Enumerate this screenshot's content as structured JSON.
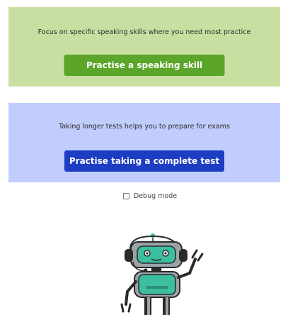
{
  "speaking_skill": {
    "description": "Focus on specific speaking skills where you need most practice",
    "button_label": "Practise a speaking skill",
    "panel_color": "#c8dfa2",
    "button_color": "#5aa52a"
  },
  "complete_test": {
    "description": "Taking longer tests helps you to prepare for exams",
    "button_label": "Practise taking a complete test",
    "panel_color": "#c1cdfc",
    "button_color": "#1d3ec2"
  },
  "debug": {
    "label": "Debug mode",
    "checked": false
  },
  "mascot": {
    "icon": "robot-mascot-icon",
    "body_color": "#3cbf9f"
  }
}
